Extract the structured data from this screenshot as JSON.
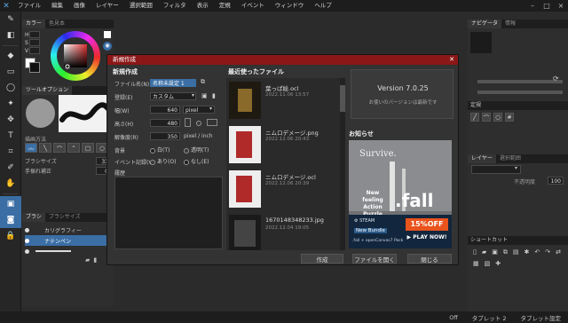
{
  "menu": {
    "items": [
      "ファイル",
      "編集",
      "画像",
      "レイヤー",
      "選択範囲",
      "フィルタ",
      "表示",
      "定規",
      "イベント",
      "ウィンドウ",
      "ヘルプ"
    ],
    "window_controls": [
      "–",
      "□",
      "×"
    ]
  },
  "left_panel": {
    "color_tabs": [
      "カラー",
      "色見本"
    ],
    "hsv_labels": [
      "H",
      "S",
      "V"
    ],
    "tool_option_tab": "ツールオプション",
    "draw_method_label": "描画方法",
    "slider_labels": [
      "ブラシサイズ",
      "手振れ補正"
    ],
    "slider_values": [
      "33",
      "0"
    ],
    "brush_tabs": [
      "ブラシ",
      "ブラシサイズ"
    ],
    "brush_items": [
      "カリグラフィー",
      "ナテンペン"
    ]
  },
  "dialog": {
    "title": "新規作成",
    "new_section_title": "新規作成",
    "file_name_label": "ファイル名(N)",
    "file_name_value": "名称未設定 1",
    "preset_label": "登録(E)",
    "preset_value": "カスタム",
    "width_label": "幅(W)",
    "width_value": "640",
    "width_unit": "pixel",
    "height_label": "高さ(H)",
    "height_value": "480",
    "resolution_label": "解像度(R)",
    "resolution_value": "350",
    "resolution_unit": "pixel / inch",
    "bg_label": "背景",
    "bg_options": [
      "白(T)",
      "透明(T)"
    ],
    "event_label": "イベント記録(V)",
    "event_options": [
      "あり(O)",
      "なし(E)"
    ],
    "history_label": "履歴",
    "recent_title": "最近使ったファイル",
    "recent_files": [
      {
        "name": "葉っぱ絵.ocl",
        "date": "2022.11.06 13:57"
      },
      {
        "name": "ニムロデメージ.png",
        "date": "2022.12.06 20:43"
      },
      {
        "name": "ニムロデメージ.ocl",
        "date": "2022.12.06 20:39"
      },
      {
        "name": "1670148348233.jpg",
        "date": "2022.12.04 19:05"
      }
    ],
    "version": "Version 7.0.25",
    "version_note": "お使いのバージョンは最新です",
    "news_title": "お知らせ",
    "ad": {
      "survive": "Survive.",
      "tagline": [
        "New feeling",
        "Action",
        "Puzzle Game"
      ],
      "game": ".fall",
      "steam": "STEAM",
      "bundle": "New Bundle",
      "pack": ".fall + openCanvas7 Pack",
      "discount": "15%OFF",
      "cta": "▶ PLAY NOW!"
    },
    "buttons": {
      "create": "作成",
      "open": "ファイルを開く",
      "close": "閉じる"
    }
  },
  "right_panel": {
    "nav_tabs": [
      "ナビゲータ",
      "情報"
    ],
    "ruler_title": "定規",
    "layer_tabs": [
      "レイヤー",
      "選択範囲"
    ],
    "layer_mode": "不透明度",
    "layer_opacity": "100",
    "shortcut_title": "ショートカット"
  },
  "status": [
    "Off",
    "タブレット 2",
    "タブレット設定"
  ],
  "colors": {
    "title_bar": "#8b1717",
    "accent": "#3a6ea5",
    "ad_orange": "#e9531c"
  }
}
